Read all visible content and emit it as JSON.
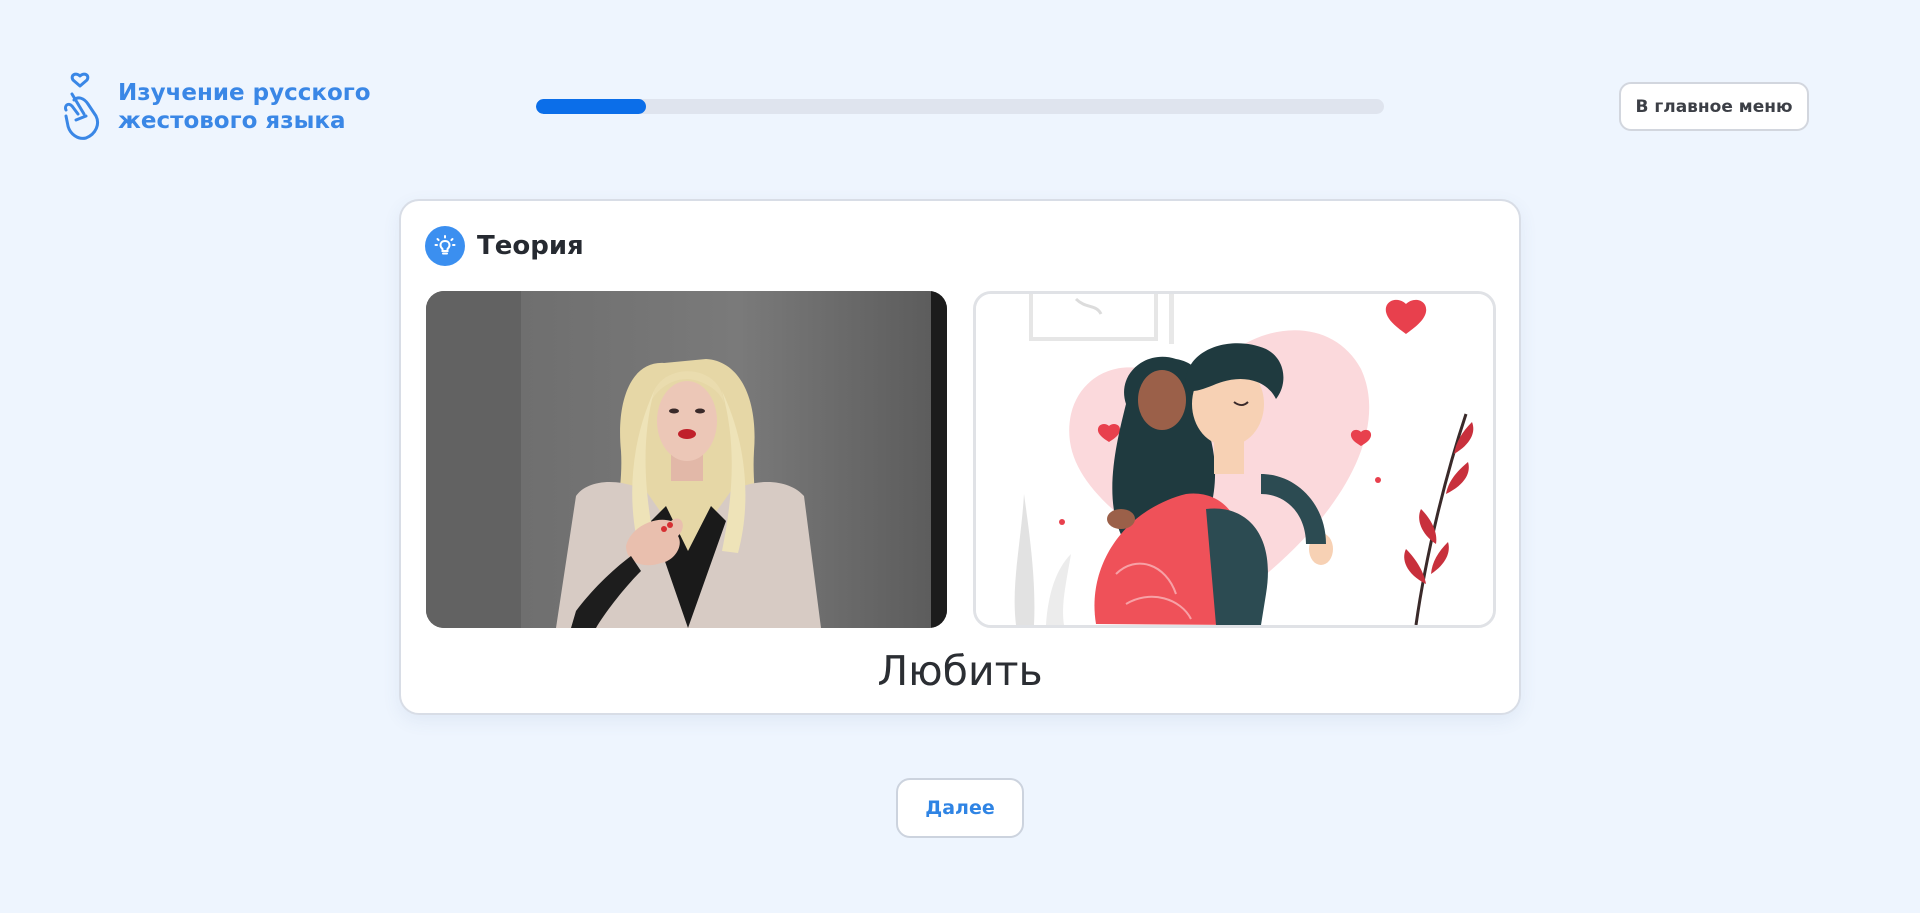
{
  "header": {
    "logo_line1": "Изучение русского",
    "logo_line2": "жестового языка",
    "logo_icon": "heart-hand-icon",
    "main_menu_label": "В главное меню"
  },
  "progress": {
    "fraction": 0.13
  },
  "card": {
    "title": "Теория",
    "title_icon": "lightbulb-icon",
    "word": "Любить"
  },
  "footer": {
    "next_label": "Далее"
  },
  "colors": {
    "background": "#eef5fe",
    "accent": "#3a87e6",
    "progress_fill": "#0b6ee9",
    "progress_track": "#dfe4ee"
  }
}
